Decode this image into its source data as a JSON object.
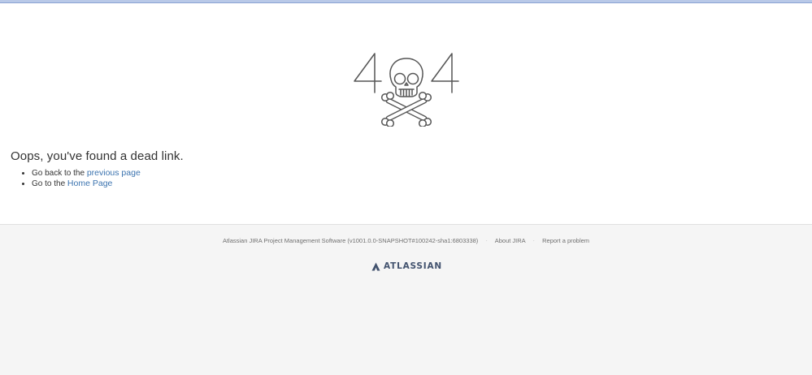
{
  "error": {
    "code_art": "404",
    "heading": "Oops, you've found a dead link.",
    "links": [
      {
        "prefix": "Go back to the",
        "link_text": "previous page"
      },
      {
        "prefix": "Go to the",
        "link_text": "Home Page"
      }
    ]
  },
  "footer": {
    "product_info": "Atlassian JIRA Project Management Software (v1001.0.0-SNAPSHOT#100242-sha1:6803338)",
    "separator": "·",
    "about_link": "About JIRA",
    "report_link": "Report a problem",
    "logo_text": "ATLASSIAN"
  },
  "colors": {
    "link": "#3b73af",
    "footer_bg": "#f5f5f5",
    "logo": "#42526e",
    "top_bar": "#b9c9e8"
  },
  "icons": {
    "illustration": "skull-crossbones-404",
    "logo_mark": "atlassian-logo-icon"
  }
}
